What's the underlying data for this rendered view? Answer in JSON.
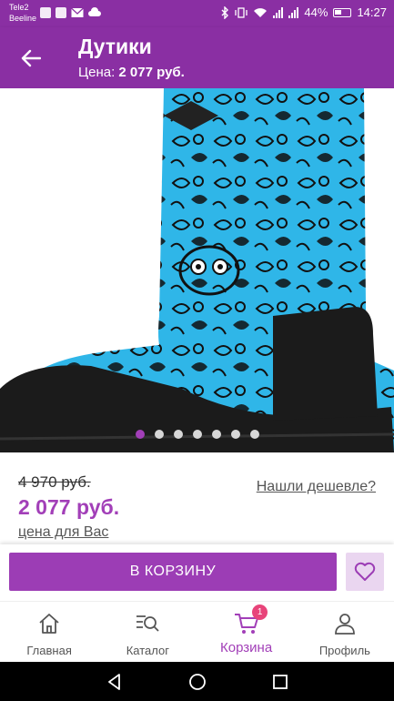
{
  "status_bar": {
    "carrier1": "Tele2",
    "carrier2": "Beeline",
    "battery": "44%",
    "time": "14:27"
  },
  "header": {
    "title": "Дутики",
    "price_label": "Цена:",
    "price_value": "2 077 руб."
  },
  "carousel": {
    "dot_count": 7,
    "active_index": 0
  },
  "pricing": {
    "old_price": "4 970 руб.",
    "new_price": "2 077 руб.",
    "note": "цена для Вас",
    "cheaper_link": "Нашли дешевле?"
  },
  "actions": {
    "cart_label": "В КОРЗИНУ"
  },
  "nav": {
    "items": [
      {
        "label": "Главная",
        "icon": "home-icon"
      },
      {
        "label": "Каталог",
        "icon": "catalog-search-icon"
      },
      {
        "label": "Корзина",
        "icon": "cart-icon",
        "badge": "1"
      },
      {
        "label": "Профиль",
        "icon": "profile-icon"
      }
    ]
  },
  "colors": {
    "brand": "#8a2fa3",
    "accent": "#a23fb8",
    "badge": "#e8447a"
  }
}
